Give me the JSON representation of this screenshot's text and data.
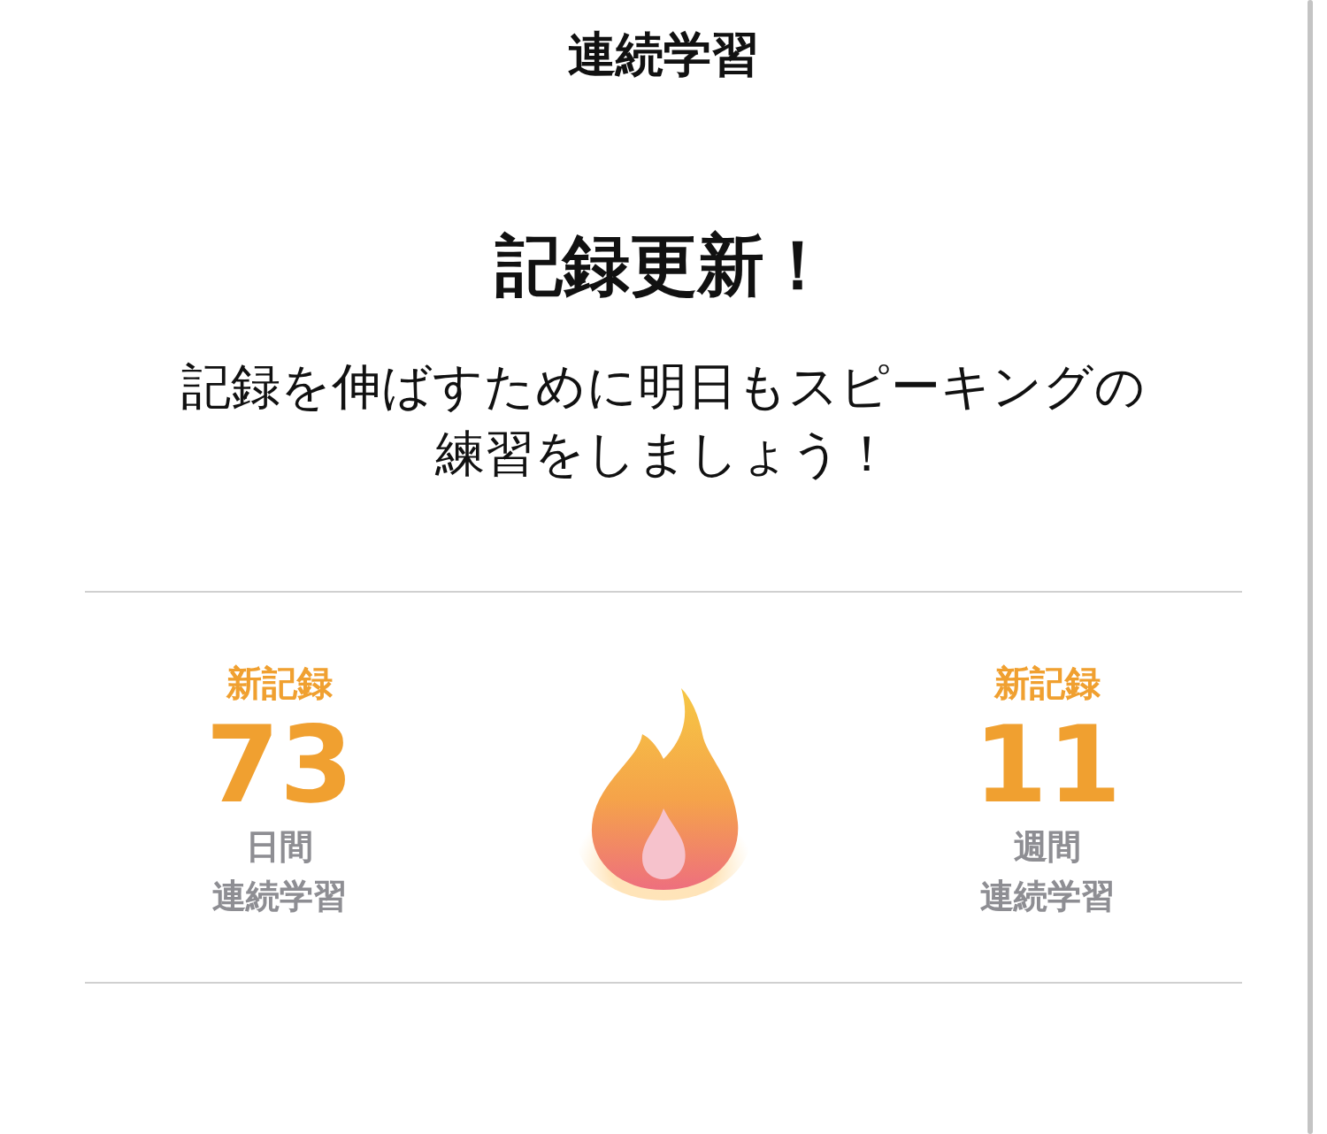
{
  "nav_title": "連続学習",
  "heading": "記録更新！",
  "message": "記録を伸ばすために明日もスピーキングの練習をしましょう！",
  "stats": [
    {
      "badge": "新記録",
      "value": "73",
      "unit": "日間",
      "label": "連続学習"
    },
    {
      "badge": "新記録",
      "value": "11",
      "unit": "週間",
      "label": "連続学習"
    }
  ]
}
